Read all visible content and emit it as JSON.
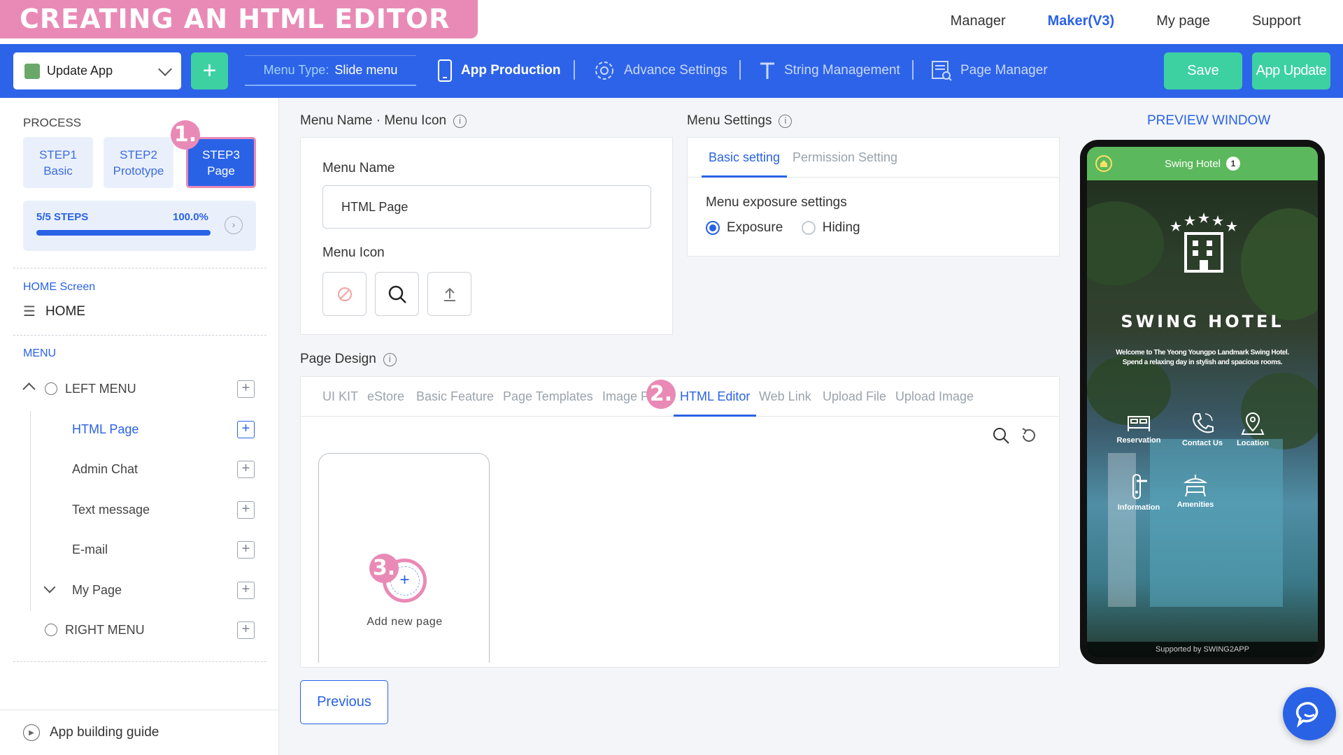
{
  "banner": {
    "title": "CREATING AN HTML EDITOR PAGE"
  },
  "topnav": [
    {
      "label": "Manager"
    },
    {
      "label": "Maker(V3)",
      "active": true
    },
    {
      "label": "My page"
    },
    {
      "label": "Support"
    }
  ],
  "toolbar": {
    "app_select": "Update App",
    "add_symbol": "+",
    "menu_type_label": "Menu Type:",
    "menu_type_value": "Slide menu",
    "app_production": "App Production",
    "advance_settings": "Advance Settings",
    "string_management": "String Management",
    "page_manager": "Page Manager",
    "save": "Save",
    "app_update": "App Update"
  },
  "sidebar": {
    "process_label": "PROCESS",
    "steps": [
      {
        "line1": "STEP1",
        "line2": "Basic"
      },
      {
        "line1": "STEP2",
        "line2": "Prototype"
      },
      {
        "line1": "STEP3",
        "line2": "Page",
        "active": true
      }
    ],
    "progress_steps": "5/5 STEPS",
    "progress_percent": "100.0%",
    "progress_value": 1.0,
    "home_section": "HOME Screen",
    "home_item": "HOME",
    "menu_section": "MENU",
    "left_menu": "LEFT MENU",
    "items": [
      "HTML Page",
      "Admin Chat",
      "Text message",
      "E-mail",
      "My Page"
    ],
    "right_menu": "RIGHT MENU",
    "guide": "App building guide"
  },
  "badges": {
    "one": "1.",
    "two": "2.",
    "three": "3."
  },
  "menu_name_section": {
    "title": "Menu Name · Menu Icon",
    "name_label": "Menu Name",
    "name_value": "HTML Page",
    "icon_label": "Menu Icon"
  },
  "menu_settings": {
    "title": "Menu Settings",
    "tabs": [
      "Basic setting",
      "Permission Setting"
    ],
    "exposure_label": "Menu exposure settings",
    "options": [
      "Exposure",
      "Hiding"
    ],
    "selected": "Exposure"
  },
  "page_design": {
    "title": "Page Design",
    "tabs": [
      "UI KIT",
      "eStore",
      "Basic Feature",
      "Page Templates",
      "Image P",
      "HTML Editor",
      "Web Link",
      "Upload File",
      "Upload Image"
    ],
    "active_tab": "HTML Editor",
    "add_symbol": "+",
    "add_label": "Add new page"
  },
  "previous": "Previous",
  "preview": {
    "title": "PREVIEW WINDOW",
    "header_title": "Swing Hotel",
    "header_badge": "1",
    "hotel_name": "SWING HOTEL",
    "hotel_desc": "Welcome to The Yeong Youngpo Landmark Swing Hotel. Spend a relaxing day in stylish and spacious rooms.",
    "icons": [
      "Reservation",
      "Contact Us",
      "Location",
      "Information",
      "Amenities"
    ],
    "footer": "Supported by SWING2APP"
  },
  "colors": {
    "primary": "#2d63e8",
    "accent_green": "#3dd1a1",
    "highlight_pink": "#e98ab6",
    "preview_header": "#5cb85c"
  }
}
